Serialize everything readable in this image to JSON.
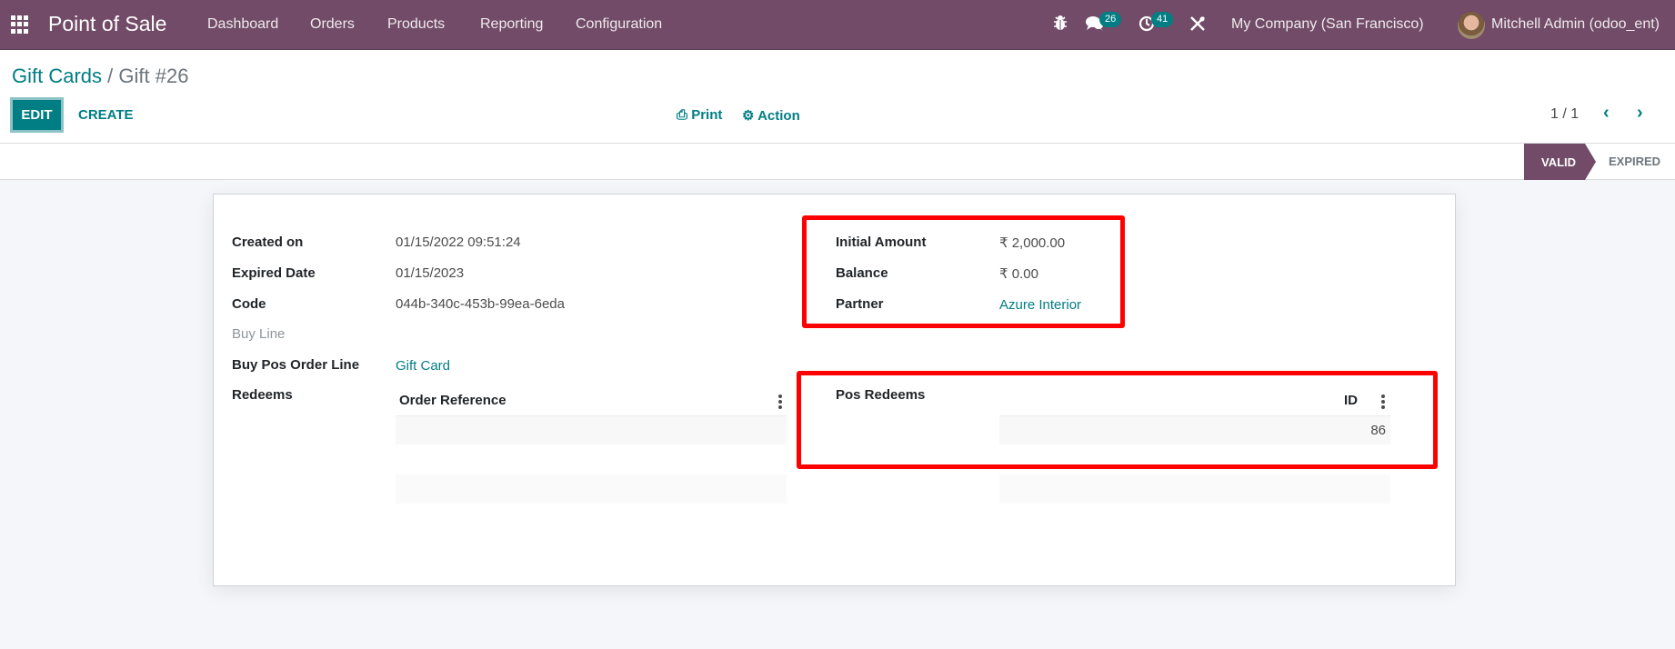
{
  "navbar": {
    "app_title": "Point of Sale",
    "menu": [
      "Dashboard",
      "Orders",
      "Products",
      "Reporting",
      "Configuration"
    ],
    "icons": {
      "apps": "apps-grid-icon",
      "debug": "bug-icon",
      "messages": "chat-icon",
      "activities": "clock-icon",
      "tools": "tools-icon"
    },
    "messages_count": "26",
    "activities_count": "41",
    "company": "My Company (San Francisco)",
    "user": "Mitchell Admin (odoo_ent)",
    "color": "#714B67"
  },
  "breadcrumb": {
    "parent": "Gift Cards",
    "separator": "/",
    "current": "Gift #26"
  },
  "toolbar": {
    "edit_label": "EDIT",
    "create_label": "CREATE",
    "print_label": "Print",
    "action_label": "Action",
    "print_icon": "⎙",
    "action_icon": "⚙"
  },
  "pager": {
    "value": "1 / 1",
    "prev": "‹",
    "next": "›"
  },
  "statusbar": {
    "states": [
      "VALID",
      "EXPIRED"
    ],
    "active": "VALID"
  },
  "form": {
    "left": [
      {
        "label": "Created on",
        "value": "01/15/2022 09:51:24"
      },
      {
        "label": "Expired Date",
        "value": "01/15/2023"
      },
      {
        "label": "Code",
        "value": "044b-340c-453b-99ea-6eda"
      },
      {
        "label": "Buy Line",
        "value": ""
      },
      {
        "label": "Buy Pos Order Line",
        "value": "Gift Card"
      },
      {
        "label": "Redeems",
        "value": ""
      }
    ],
    "right": [
      {
        "label": "Initial Amount",
        "value": "₹ 2,000.00"
      },
      {
        "label": "Balance",
        "value": "₹ 0.00"
      },
      {
        "label": "Partner",
        "value": "Azure Interior"
      }
    ],
    "redeems_table": {
      "columns": [
        "Order Reference"
      ],
      "rows": []
    },
    "pos_redeems": {
      "label": "Pos Redeems",
      "columns": [
        "ID"
      ],
      "rows": [
        [
          "86"
        ]
      ]
    }
  },
  "colors": {
    "brand": "#714B67",
    "accent": "#017e84",
    "highlight": "#ff0000"
  }
}
